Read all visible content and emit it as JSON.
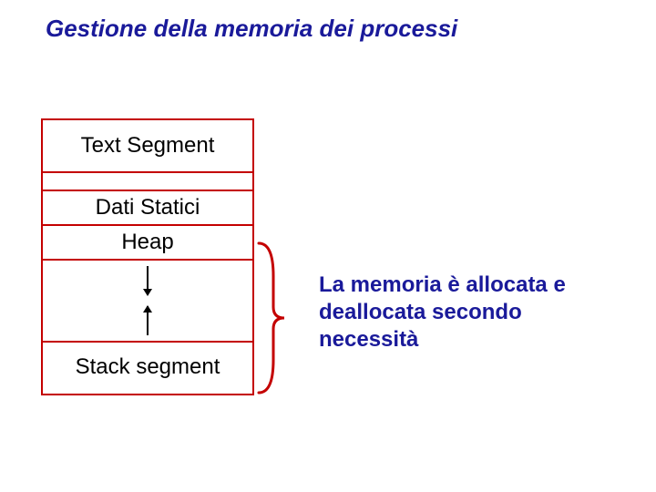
{
  "title": "Gestione della memoria dei processi",
  "segments": {
    "text": "Text Segment",
    "dati": "Dati Statici",
    "heap": "Heap",
    "stack": "Stack segment"
  },
  "annotation": "La memoria è allocata e deallocata secondo necessità"
}
